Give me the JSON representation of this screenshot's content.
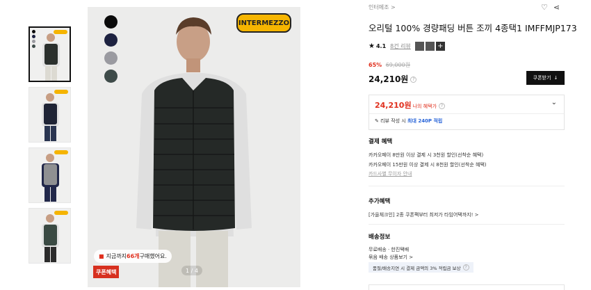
{
  "colors": {
    "accent_red": "#e0301e",
    "accent_blue": "#2864d8",
    "brand_yellow": "#f6b500"
  },
  "thumbnails": [
    {
      "vest_color": "#2b302d",
      "sweater": "#e4e4e4"
    },
    {
      "vest_color": "#1f2435",
      "sweater": "#e4e4e4"
    },
    {
      "vest_color": "#8f9092",
      "sweater": "#22284a"
    },
    {
      "vest_color": "#3a4a43",
      "sweater": "#e4e4e4"
    }
  ],
  "swatches": [
    "#0b0b0b",
    "#1d2240",
    "#9a9aa0",
    "#3e4b49"
  ],
  "image": {
    "brand": "INTERMEZZO",
    "purchase_prefix": "지금까지 ",
    "purchase_count": "66개",
    "purchase_suffix": " 구매했어요.",
    "coupon_badge": "쿠폰혜택",
    "pager": "1 / 4"
  },
  "product": {
    "breadcrumb": "인터메조 >",
    "title": "오리털 100% 경량패딩 버튼 조끼 4종택1 IMFFMJP173",
    "rating": "4.1",
    "reviews": "8건 리뷰",
    "discount_rate": "65%",
    "original_price": "69,000원",
    "price": "24,210원",
    "coupon_button": "쿠폰받기",
    "my_price": "24,210원",
    "my_price_label": "나의 혜택가",
    "review_point_prefix": "리뷰 작성 시 ",
    "review_point_hl": "최대 240P 적립"
  },
  "payment": {
    "title": "결제 혜택",
    "line1": "카카오페이 8만원 이상 결제 시 3천원 할인(선착순 혜택)",
    "line2": "카카오페이 15만원 이상 결제 시 8천원 할인(선착순 혜택)",
    "more": "카드사별 무이자 안내"
  },
  "extra": {
    "title": "추가혜택",
    "line1": "[가을체크인] 2종 쿠폰팩부터 최저가 타임어택까지! >"
  },
  "shipping": {
    "title": "배송정보",
    "line1": "무료배송 · 한진택배",
    "line2": "묶음 배송 상품보기 >",
    "note": "품절/배송지연 시 결제 금액의 3% 적립금 보상"
  }
}
